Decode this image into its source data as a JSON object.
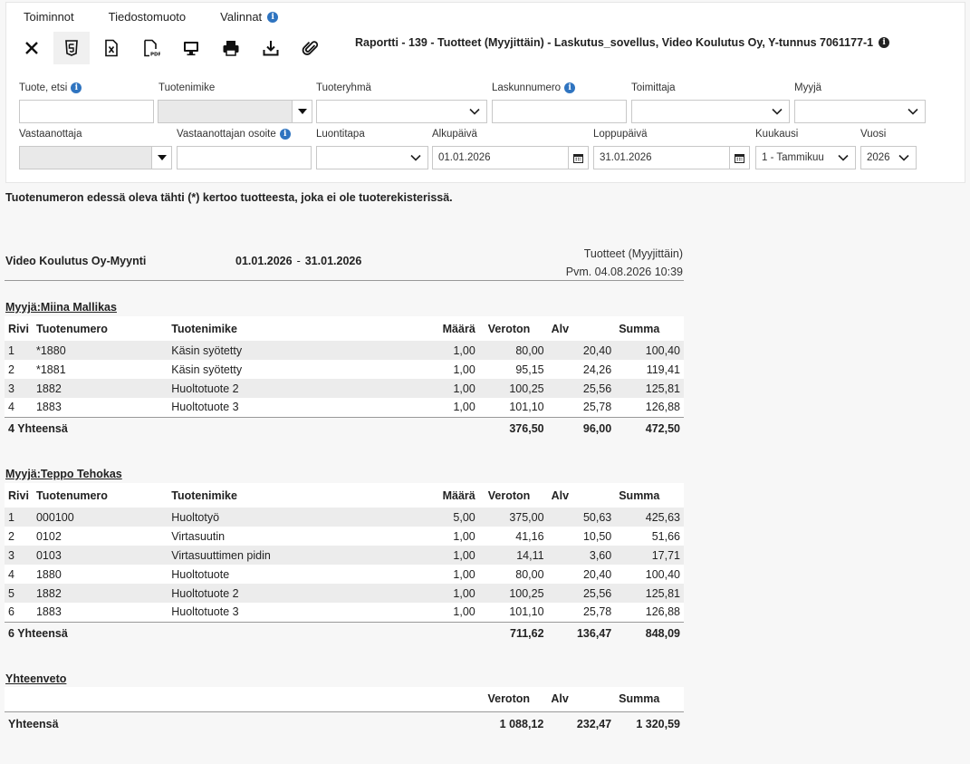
{
  "menu": {
    "actions": "Toiminnot",
    "format": "Tiedostomuoto",
    "options": "Valinnat"
  },
  "report_title": "Raportti - 139 - Tuotteet (Myyjittäin) - Laskutus_sovellus, Video Koulutus Oy, Y-tunnus 7061177-1",
  "filters": {
    "product_search": {
      "label": "Tuote, etsi",
      "value": ""
    },
    "product_name": {
      "label": "Tuotenimike",
      "value": ""
    },
    "product_group": {
      "label": "Tuoteryhmä",
      "value": ""
    },
    "invoice_number": {
      "label": "Laskunnumero",
      "value": ""
    },
    "supplier": {
      "label": "Toimittaja",
      "value": ""
    },
    "seller": {
      "label": "Myyjä",
      "value": ""
    },
    "recipient": {
      "label": "Vastaanottaja",
      "value": ""
    },
    "recipient_address": {
      "label": "Vastaanottajan osoite",
      "value": ""
    },
    "creation_method": {
      "label": "Luontitapa",
      "value": ""
    },
    "start_date": {
      "label": "Alkupäivä",
      "value": "01.01.2026"
    },
    "end_date": {
      "label": "Loppupäivä",
      "value": "31.01.2026"
    },
    "month": {
      "label": "Kuukausi",
      "value": "1 - Tammikuu"
    },
    "year": {
      "label": "Vuosi",
      "value": "2026"
    }
  },
  "note": "Tuotenumeron edessä oleva tähti (*) kertoo tuotteesta, joka ei ole tuoterekisterissä.",
  "report": {
    "company": "Video Koulutus Oy-Myynti",
    "start": "01.01.2026",
    "date_sep": "-",
    "end": "31.01.2026",
    "type": "Tuotteet (Myyjittäin)",
    "printed": "Pvm. 04.08.2026 10:39"
  },
  "columns": {
    "row": "Rivi",
    "number": "Tuotenumero",
    "name": "Tuotenimike",
    "qty": "Määrä",
    "net": "Veroton",
    "vat": "Alv",
    "sum": "Summa"
  },
  "sellers": [
    {
      "title": "Myyjä:Miina Mallikas",
      "rows": [
        [
          "1",
          "*1880",
          "Käsin syötetty",
          "1,00",
          "80,00",
          "20,40",
          "100,40"
        ],
        [
          "2",
          "*1881",
          "Käsin syötetty",
          "1,00",
          "95,15",
          "24,26",
          "119,41"
        ],
        [
          "3",
          "1882",
          "Huoltotuote 2",
          "1,00",
          "100,25",
          "25,56",
          "125,81"
        ],
        [
          "4",
          "1883",
          "Huoltotuote 3",
          "1,00",
          "101,10",
          "25,78",
          "126,88"
        ]
      ],
      "total": {
        "label": "4 Yhteensä",
        "net": "376,50",
        "vat": "96,00",
        "sum": "472,50"
      }
    },
    {
      "title": "Myyjä:Teppo Tehokas",
      "rows": [
        [
          "1",
          "000100",
          "Huoltotyö",
          "5,00",
          "375,00",
          "50,63",
          "425,63"
        ],
        [
          "2",
          "0102",
          "Virtasuutin",
          "1,00",
          "41,16",
          "10,50",
          "51,66"
        ],
        [
          "3",
          "0103",
          "Virtasuuttimen pidin",
          "1,00",
          "14,11",
          "3,60",
          "17,71"
        ],
        [
          "4",
          "1880",
          "Huoltotuote",
          "1,00",
          "80,00",
          "20,40",
          "100,40"
        ],
        [
          "5",
          "1882",
          "Huoltotuote 2",
          "1,00",
          "100,25",
          "25,56",
          "125,81"
        ],
        [
          "6",
          "1883",
          "Huoltotuote 3",
          "1,00",
          "101,10",
          "25,78",
          "126,88"
        ]
      ],
      "total": {
        "label": "6 Yhteensä",
        "net": "711,62",
        "vat": "136,47",
        "sum": "848,09"
      }
    }
  ],
  "summary": {
    "title": "Yhteenveto",
    "label": "Yhteensä",
    "net": "1 088,12",
    "vat": "232,47",
    "sum": "1 320,59"
  }
}
